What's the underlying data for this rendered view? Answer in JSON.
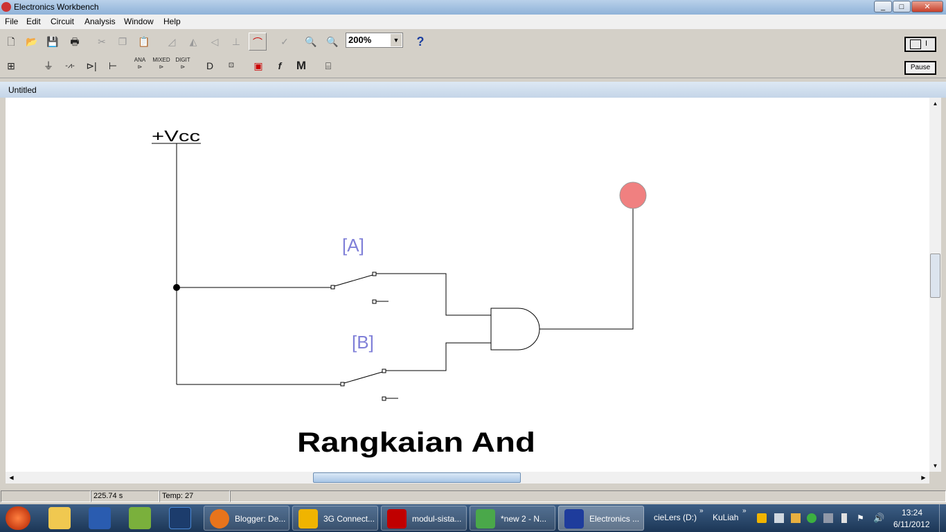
{
  "window": {
    "title": "Electronics Workbench",
    "controls": {
      "minimize": "_",
      "maximize": "□",
      "close": "✕"
    }
  },
  "menu": [
    "File",
    "Edit",
    "Circuit",
    "Analysis",
    "Window",
    "Help"
  ],
  "toolbar": {
    "zoom_value": "200%",
    "help_label": "?",
    "pause_label": "Pause",
    "power_label": "I",
    "bins": {
      "analog": "ANA",
      "mixed": "MIXED",
      "digital": "DIGIT",
      "function": "f",
      "misc": "M"
    }
  },
  "document": {
    "title": "Untitled"
  },
  "circuit": {
    "vcc_label": "+Vcc",
    "switch_a_label": "[A]",
    "switch_b_label": "[B]",
    "caption": "Rangkaian And",
    "lamp_color": "#f08080",
    "label_color": "#8080d8"
  },
  "status": {
    "time": "225.74 s",
    "temp": "Temp:  27"
  },
  "taskbar": {
    "tasks": [
      {
        "label": "Blogger: De...",
        "color": "#e8741c"
      },
      {
        "label": "3G Connect...",
        "color": "#f0b400"
      },
      {
        "label": "modul-sista...",
        "color": "#c00000"
      },
      {
        "label": "*new  2 - N...",
        "color": "#4aa84a"
      },
      {
        "label": "Electronics ...",
        "color": "#1e3c9c"
      }
    ],
    "toolbar_items": [
      "cieLers (D:)",
      "KuLiah"
    ],
    "clock": {
      "time": "13:24",
      "date": "6/11/2012"
    }
  }
}
